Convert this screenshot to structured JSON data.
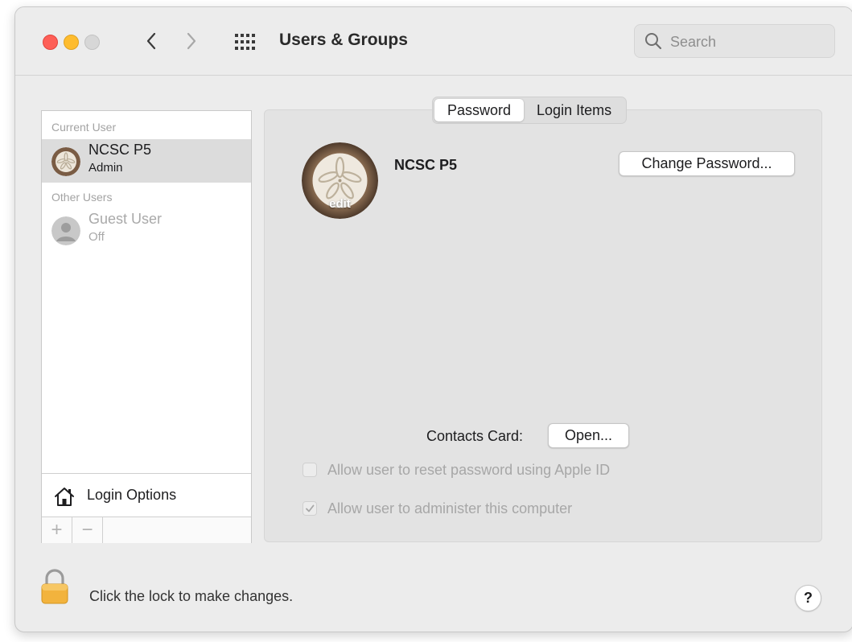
{
  "window": {
    "title": "Users & Groups",
    "search": {
      "placeholder": "Search",
      "value": ""
    }
  },
  "sidebar": {
    "current_user_header": "Current User",
    "other_users_header": "Other Users",
    "users": [
      {
        "name": "NCSC P5",
        "role": "Admin",
        "selected": true,
        "avatar": "sand-dollar-avatar"
      },
      {
        "name": "Guest User",
        "role": "Off",
        "selected": false,
        "avatar": "generic-person-avatar"
      }
    ],
    "login_options": "Login Options",
    "add_label": "+",
    "remove_label": "−"
  },
  "tabs": [
    {
      "label": "Password",
      "active": true
    },
    {
      "label": "Login Items",
      "active": false
    }
  ],
  "account": {
    "name": "NCSC P5",
    "edit_label": "edit",
    "change_password_label": "Change Password...",
    "contacts_card_label": "Contacts Card:",
    "open_label": "Open..."
  },
  "options": {
    "reset_with_apple_id": {
      "label": "Allow user to reset password using Apple ID",
      "checked": false,
      "enabled": false
    },
    "administer_computer": {
      "label": "Allow user to administer this computer",
      "checked": true,
      "enabled": false
    }
  },
  "footer": {
    "lock_text": "Click the lock to make changes.",
    "help_label": "?"
  },
  "colors": {
    "close": "#fe5f57",
    "minimize": "#febc2e",
    "zoom_disabled": "#d7d7d7",
    "lock": "#f2b33d"
  }
}
